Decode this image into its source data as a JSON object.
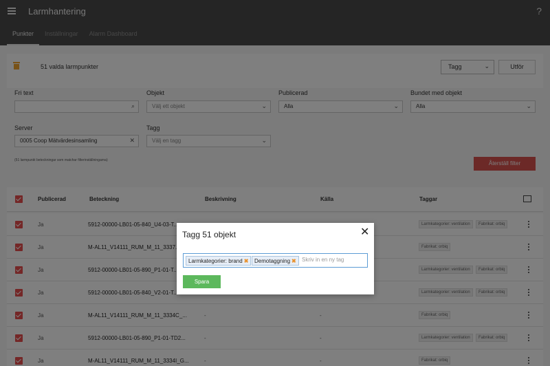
{
  "app": {
    "title": "Larmhantering",
    "help": "?"
  },
  "tabs": [
    "Punkter",
    "Inställningar",
    "Alarm Dashboard"
  ],
  "toolbar": {
    "selected_text": "51 valda larmpunkter",
    "action_select": "Tagg",
    "execute_label": "Utför"
  },
  "filters": {
    "fritext_label": "Fri text",
    "fritext_value": "",
    "objekt_label": "Objekt",
    "objekt_placeholder": "Välj ett objekt",
    "publicerad_label": "Publicerad",
    "publicerad_value": "Alla",
    "bundet_label": "Bundet med objekt",
    "bundet_value": "Alla",
    "server_label": "Server",
    "server_value": "0005 Coop Mätvärdesinsamling",
    "tagg_label": "Tagg",
    "tagg_placeholder": "Välj en tagg",
    "match_note": "(51 larmpunkt beteckningar som matchar filterinställningarna)",
    "reset_label": "Återställ filter"
  },
  "table": {
    "headers": {
      "publicerad": "Publicerad",
      "beteckning": "Beteckning",
      "beskrivning": "Beskrivning",
      "kalla": "Källa",
      "taggar": "Taggar"
    },
    "rows": [
      {
        "publicerad": "Ja",
        "beteckning": "5912-00000-LB01-05-840_U4-03-T...",
        "beskrivning": "",
        "kalla": "",
        "tags": [
          "Larmkategorier: ventilation",
          "Fabrikat: orbiq"
        ]
      },
      {
        "publicerad": "Ja",
        "beteckning": "M-AL11_V14111_RUM_M_11_3337...",
        "beskrivning": "",
        "kalla": "",
        "tags": [
          "Fabrikat: orbiq"
        ]
      },
      {
        "publicerad": "Ja",
        "beteckning": "5912-00000-LB01-05-890_P1-01-T...",
        "beskrivning": "",
        "kalla": "",
        "tags": [
          "Larmkategorier: ventilation",
          "Fabrikat: orbiq"
        ]
      },
      {
        "publicerad": "Ja",
        "beteckning": "5912-00000-LB01-05-840_V2-01-T...",
        "beskrivning": "",
        "kalla": "",
        "tags": [
          "Larmkategorier: ventilation",
          "Fabrikat: orbiq"
        ]
      },
      {
        "publicerad": "Ja",
        "beteckning": "M-AL11_V14111_RUM_M_11_3334C_...",
        "beskrivning": "-",
        "kalla": "-",
        "tags": [
          "Fabrikat: orbiq"
        ]
      },
      {
        "publicerad": "Ja",
        "beteckning": "5912-00000-LB01-05-890_P1-01-TD2...",
        "beskrivning": "-",
        "kalla": "-",
        "tags": [
          "Larmkategorier: ventilation",
          "Fabrikat: orbiq"
        ]
      },
      {
        "publicerad": "Ja",
        "beteckning": "M-AL11_V14111_RUM_M_11_3334I_G...",
        "beskrivning": "-",
        "kalla": "-",
        "tags": [
          "Fabrikat: orbiq"
        ]
      }
    ]
  },
  "modal": {
    "title": "Tagg 51 objekt",
    "close": "✕",
    "tags": [
      "Larmkategorier: brand",
      "Demotaggning"
    ],
    "tag_remove": "✖",
    "new_tag_placeholder": "Skriv in en ny tag",
    "save_label": "Spara"
  },
  "colors": {
    "topbar": "#4b4b4b",
    "accent_red": "#e94e4e",
    "save_green": "#5cb85c",
    "reset_red": "#d9534f",
    "trash_orange": "#f0a52e"
  }
}
